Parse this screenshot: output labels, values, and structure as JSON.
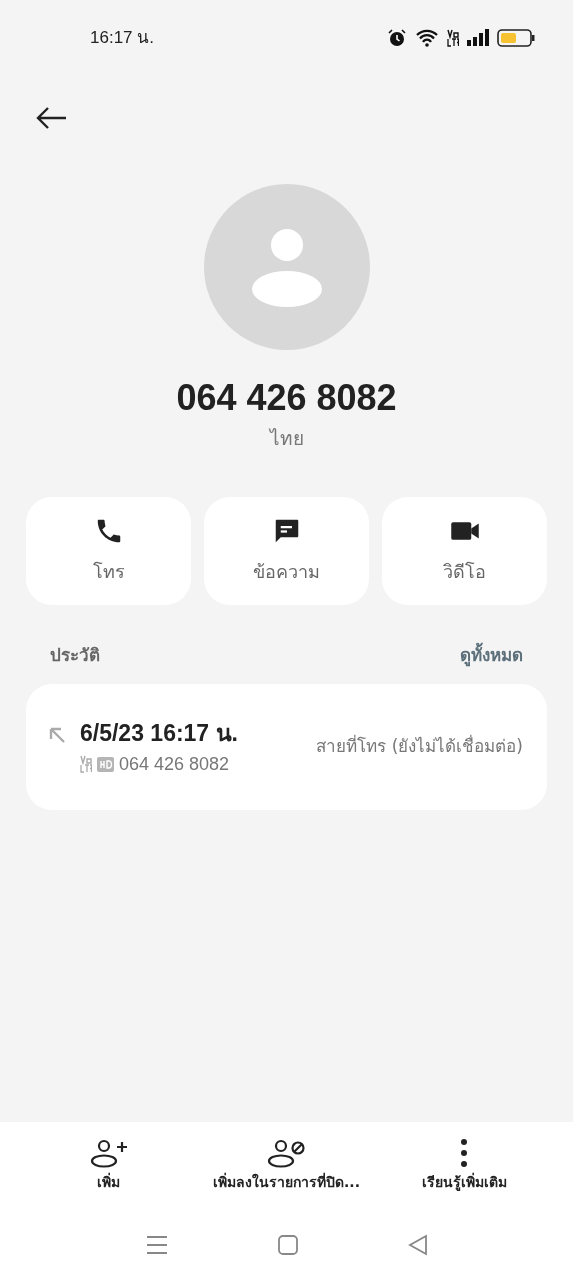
{
  "status_bar": {
    "time": "16:17 น."
  },
  "contact": {
    "number": "064 426 8082",
    "location": "ไทย"
  },
  "actions": [
    {
      "kind": "call",
      "label": "โทร"
    },
    {
      "kind": "message",
      "label": "ข้อความ"
    },
    {
      "kind": "video",
      "label": "วิดีโอ"
    }
  ],
  "history": {
    "title": "ประวัติ",
    "see_all": "ดูทั้งหมด",
    "entries": [
      {
        "datetime": "6/5/23 16:17 น.",
        "number": "064 426 8082",
        "status": "สายที่โทร (ยังไม่ได้เชื่อมต่อ)"
      }
    ]
  },
  "bottom_actions": [
    {
      "kind": "add",
      "label": "เพิ่ม"
    },
    {
      "kind": "block",
      "label": "เพิ่มลงในรายการที่ปิด..."
    },
    {
      "kind": "more",
      "label": "เรียนรู้เพิ่มเติม"
    }
  ]
}
